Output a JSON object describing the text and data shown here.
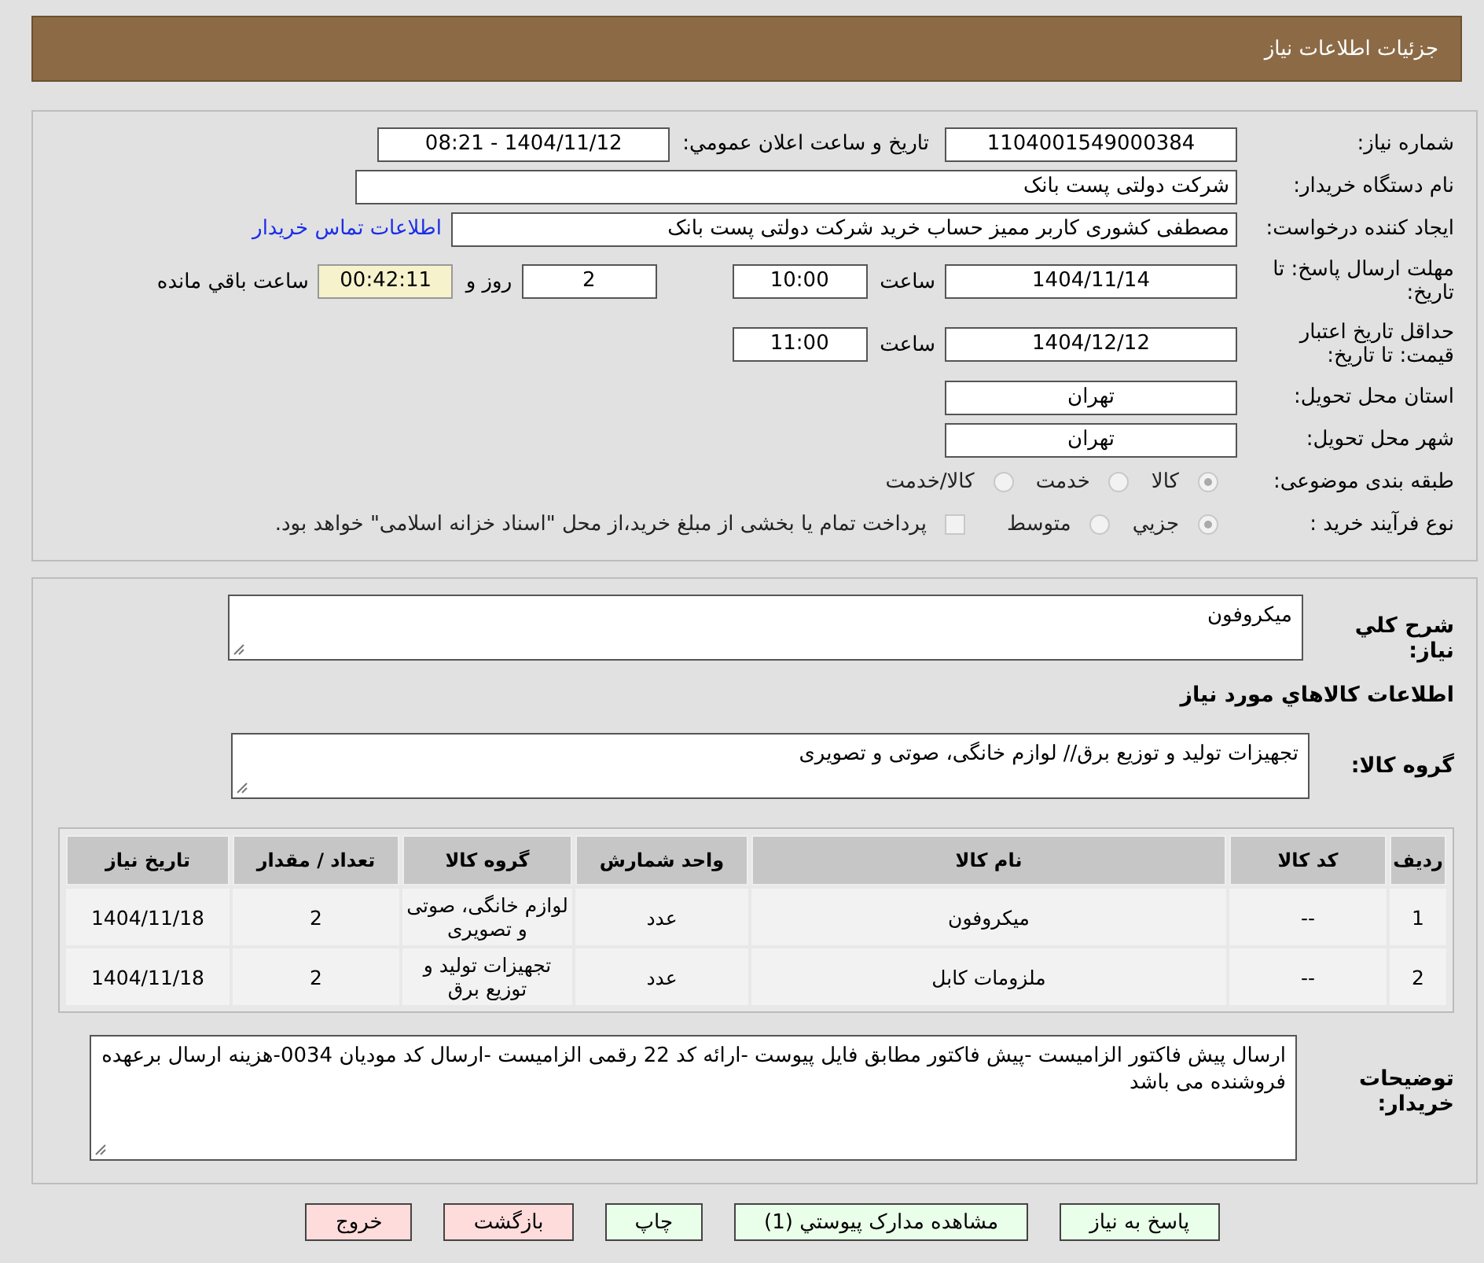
{
  "header": {
    "title": "جزئيات اطلاعات نياز"
  },
  "need_number": {
    "label": "شماره نياز:",
    "value": "1104001549000384"
  },
  "announce": {
    "label": "تاريخ و ساعت اعلان عمومي:",
    "value": "1404/11/12 - 08:21"
  },
  "buyer_org": {
    "label": "نام دستگاه خريدار:",
    "value": "شرکت دولتی پست بانک"
  },
  "requester": {
    "label": "ايجاد کننده درخواست:",
    "value": "مصطفی کشوری کاربر ممیز حساب خرید شرکت دولتی پست بانک",
    "link": "اطلاعات تماس خريدار"
  },
  "deadline": {
    "label": "مهلت ارسال پاسخ: تا تاريخ:",
    "date": "1404/11/14",
    "time_label": "ساعت",
    "time": "10:00",
    "days": "2",
    "days_label": "روز و",
    "remaining": "00:42:11",
    "remaining_label": "ساعت باقي مانده"
  },
  "validity": {
    "label": "حداقل تاريخ اعتبار قيمت: تا تاريخ:",
    "date": "1404/12/12",
    "time_label": "ساعت",
    "time": "11:00"
  },
  "province": {
    "label": "استان محل تحويل:",
    "value": "تهران"
  },
  "city": {
    "label": "شهر محل تحويل:",
    "value": "تهران"
  },
  "category": {
    "label": "طبقه بندی موضوعی:",
    "options": [
      {
        "label": "كالا",
        "selected": true
      },
      {
        "label": "خدمت",
        "selected": false
      },
      {
        "label": "كالا/خدمت",
        "selected": false
      }
    ]
  },
  "process": {
    "label": "نوع فرآيند خريد :",
    "options": [
      {
        "label": "جزيي",
        "selected": true
      },
      {
        "label": "متوسط",
        "selected": false
      }
    ],
    "payment": {
      "label": "پرداخت تمام يا بخشی از مبلغ خريد،از محل \"اسناد خزانه اسلامی\" خواهد بود.",
      "checked": false
    }
  },
  "description": {
    "label": "شرح كلي نياز:",
    "value": "ميكروفون"
  },
  "goods_title": "اطلاعات كالاهاي مورد نياز",
  "goods_group": {
    "label": "گروه كالا:",
    "value": "تجهیزات تولید و توزیع برق// لوازم خانگی، صوتی و تصویری"
  },
  "table": {
    "columns": [
      "رديف",
      "كد كالا",
      "نام كالا",
      "واحد شمارش",
      "گروه كالا",
      "تعداد / مقدار",
      "تاريخ نياز"
    ],
    "rows": [
      [
        "1",
        "--",
        "ميكروفون",
        "عدد",
        "لوازم خانگی، صوتی و تصویری",
        "2",
        "1404/11/18"
      ],
      [
        "2",
        "--",
        "ملزومات کابل",
        "عدد",
        "تجهیزات تولید و توزیع برق",
        "2",
        "1404/11/18"
      ]
    ]
  },
  "buyer_notes": {
    "label": "توضيحات خريدار:",
    "value": "ارسال پیش فاکتور الزامیست -پیش فاکتور مطابق فایل پیوست -ارائه کد 22 رقمی الزامیست -ارسال کد مودیان 0034-هزینه ارسال برعهده فروشنده می باشد"
  },
  "buttons": [
    {
      "label": "پاسخ به نياز",
      "kind": "green"
    },
    {
      "label": "مشاهده مدارک پيوستي (1)",
      "kind": "green"
    },
    {
      "label": "چاپ",
      "kind": "green"
    },
    {
      "label": "بازگشت",
      "kind": "red"
    },
    {
      "label": "خروج",
      "kind": "red"
    }
  ]
}
